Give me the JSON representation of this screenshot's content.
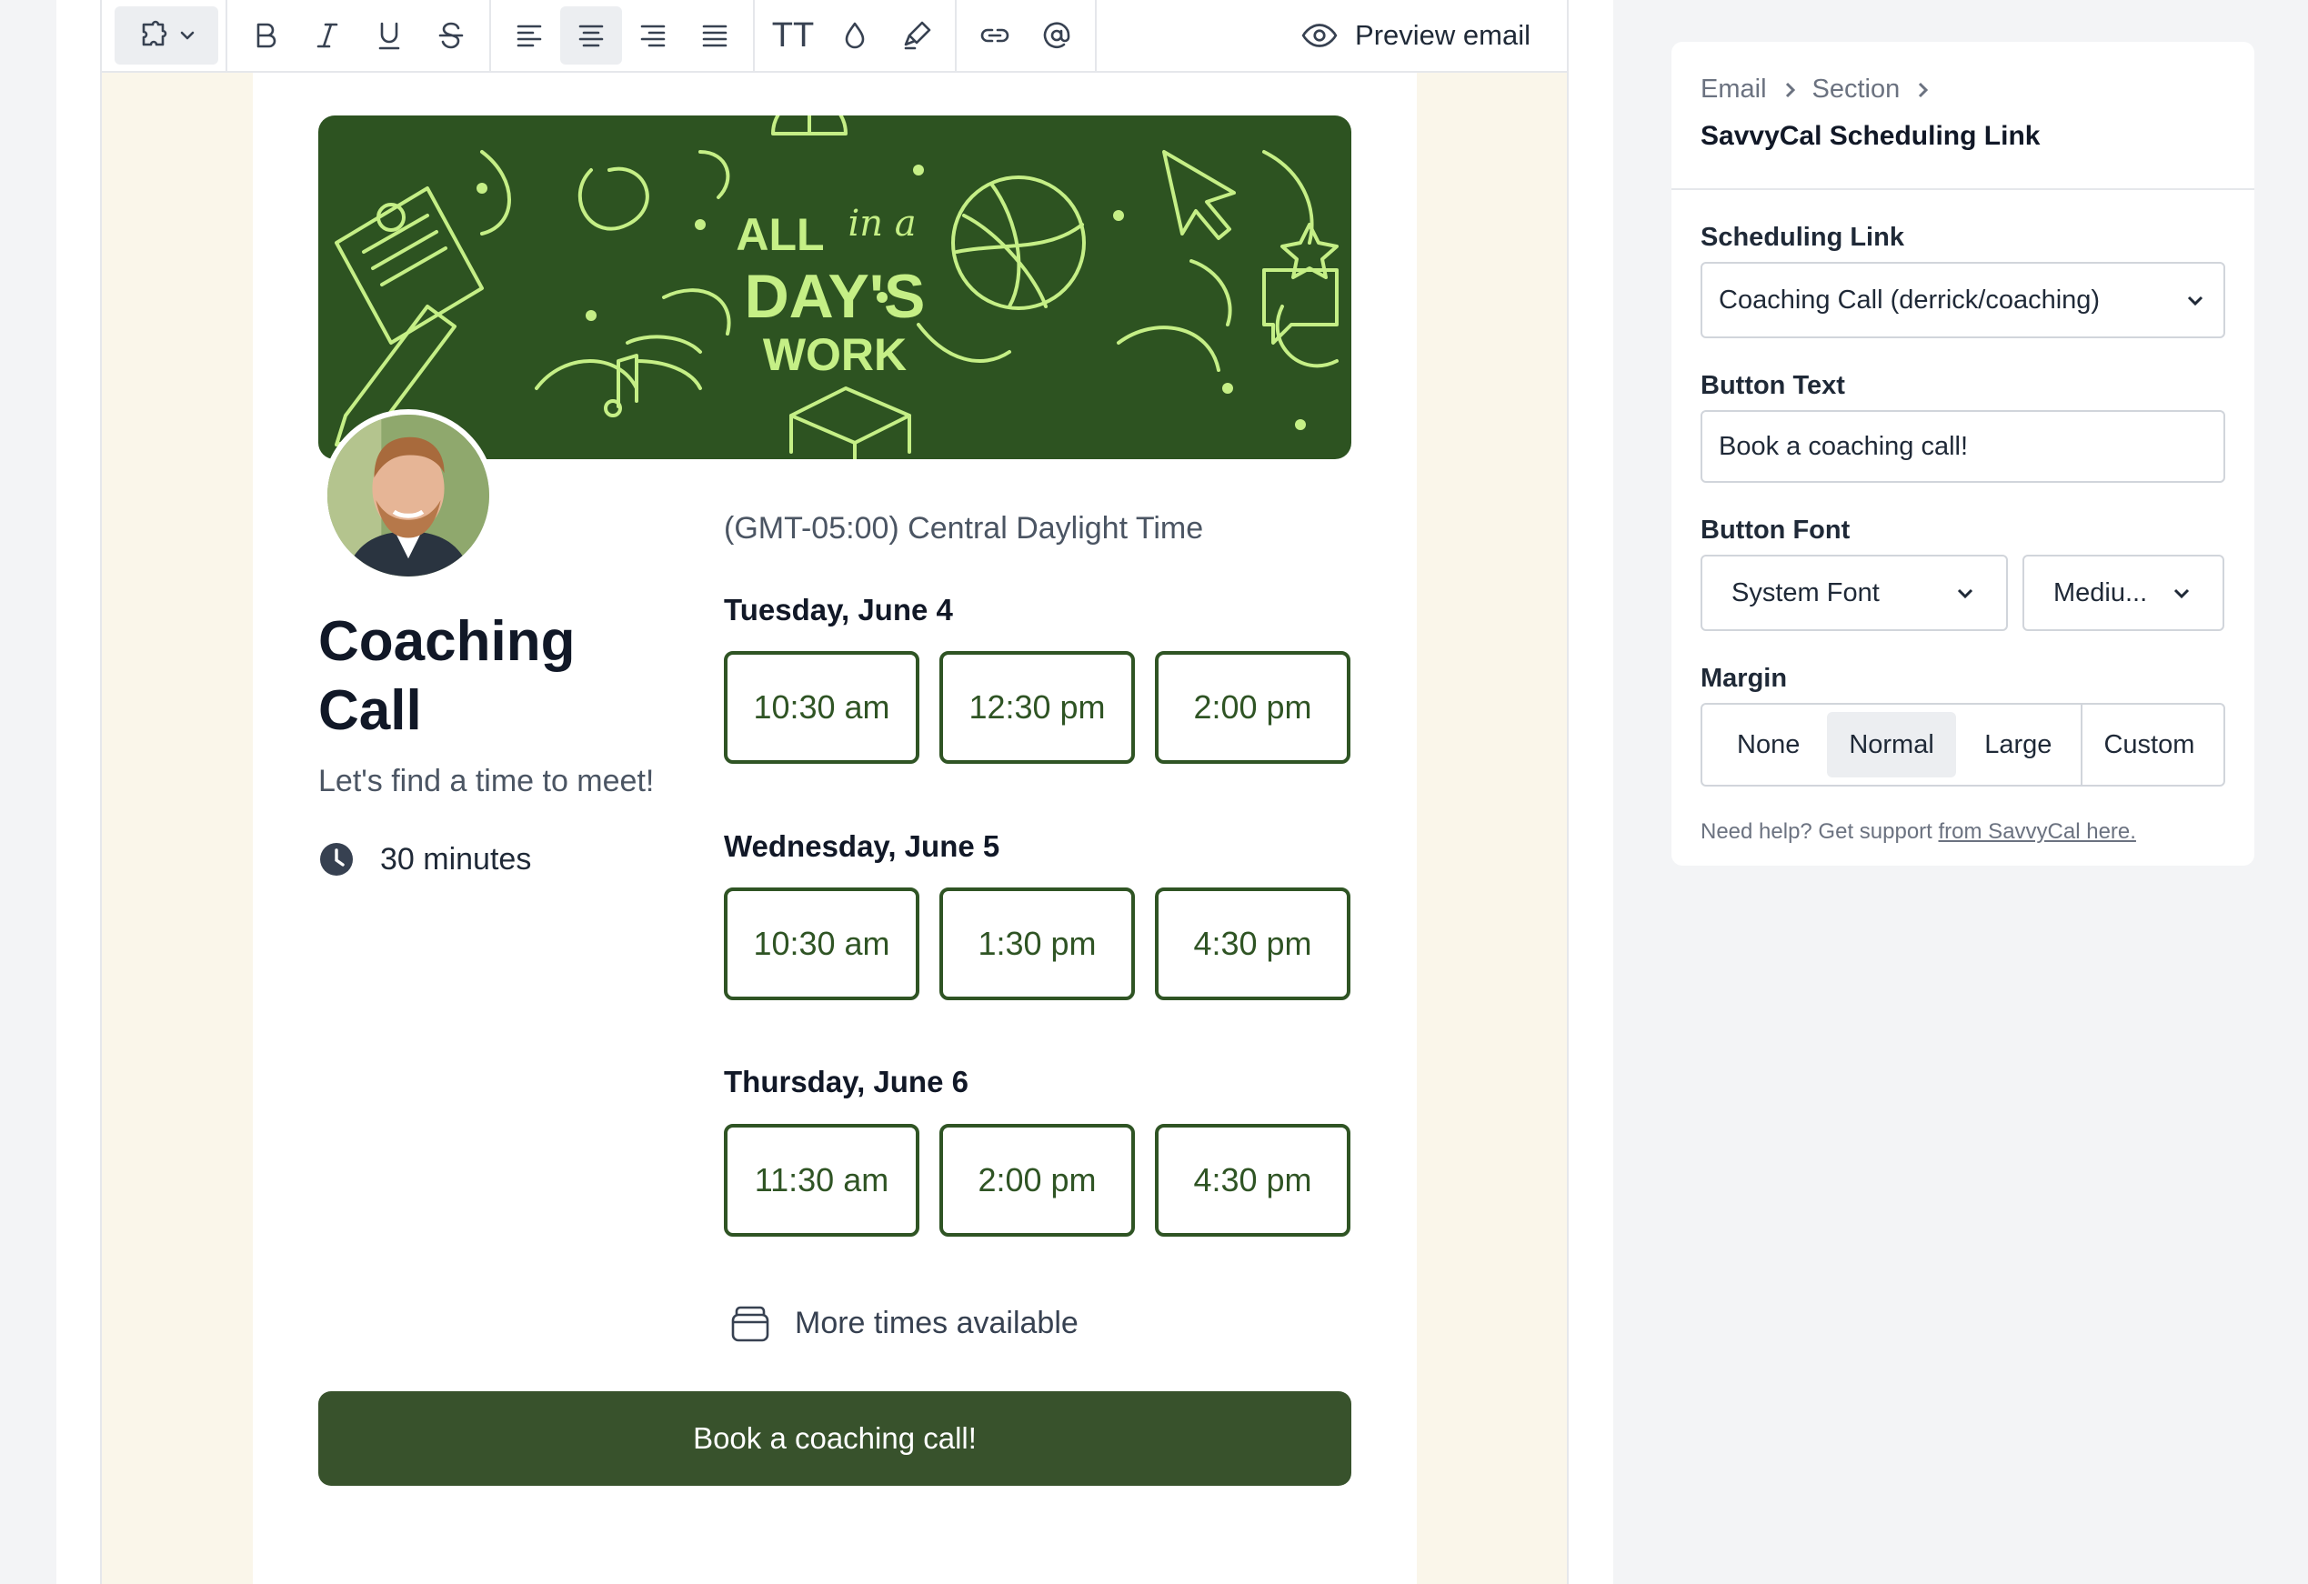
{
  "toolbar": {
    "preview_label": "Preview email",
    "font_size_glyph": "TT"
  },
  "banner": {
    "line1": "ALL",
    "line1_script": "in a",
    "line2": "DAY'S",
    "line3": "WORK"
  },
  "event": {
    "title": "Coaching Call",
    "subtitle": "Let's find a time to meet!",
    "duration": "30 minutes",
    "timezone": "(GMT-05:00) Central Daylight Time",
    "days": [
      {
        "label": "Tuesday, June 4",
        "slots": [
          "10:30 am",
          "12:30 pm",
          "2:00 pm"
        ]
      },
      {
        "label": "Wednesday, June 5",
        "slots": [
          "10:30 am",
          "1:30 pm",
          "4:30 pm"
        ]
      },
      {
        "label": "Thursday, June 6",
        "slots": [
          "11:30 am",
          "2:00 pm",
          "4:30 pm"
        ]
      }
    ],
    "more_times": "More times available",
    "button_label": "Book a coaching call!"
  },
  "panel": {
    "breadcrumbs": [
      "Email",
      "Section"
    ],
    "title": "SavvyCal Scheduling Link",
    "scheduling_link_label": "Scheduling Link",
    "scheduling_link_value": "Coaching Call (derrick/coaching)",
    "button_text_label": "Button Text",
    "button_text_value": "Book a coaching call!",
    "button_font_label": "Button Font",
    "button_font_value": "System Font",
    "button_weight_value": "Mediu...",
    "margin_label": "Margin",
    "margin_options": [
      "None",
      "Normal",
      "Large",
      "Custom"
    ],
    "margin_selected": "Normal",
    "help_prefix": "Need help? Get support ",
    "help_link": "from SavvyCal here."
  },
  "colors": {
    "brand_green": "#2f5424",
    "banner_bg": "#2d5321",
    "banner_art": "#c5ef86",
    "button_bg": "#38522c"
  }
}
